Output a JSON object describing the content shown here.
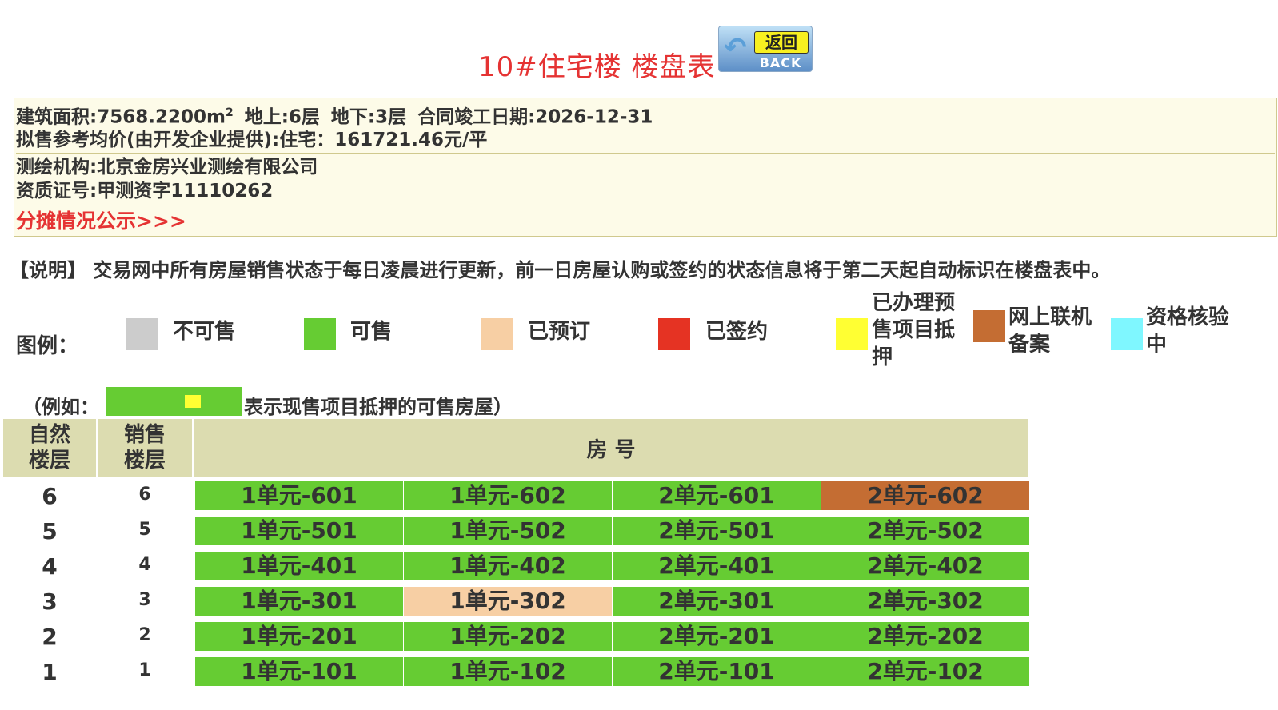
{
  "page": {
    "title": "10#住宅楼 楼盘表",
    "back_button": {
      "cn": "返回",
      "en": "BACK"
    }
  },
  "info": {
    "area_label": "建筑面积:7568.2200m",
    "area_sup": "2",
    "above_ground": "地上:6层",
    "below_ground": "地下:3层",
    "completion_date": "合同竣工日期:2026-12-31",
    "reference_price": "拟售参考均价(由开发企业提供):住宅：161721.46元/平",
    "survey_org": "测绘机构:北京金房兴业测绘有限公司",
    "cert_no": "资质证号:甲测资字11110262",
    "allocation_link": "分摊情况公示>>>"
  },
  "note": "【说明】 交易网中所有房屋销售状态于每日凌晨进行更新，前一日房屋认购或签约的状态信息将于第二天起自动标识在楼盘表中。",
  "legend": {
    "label": "图例：",
    "items": [
      {
        "label": "不可售",
        "color": "#cccccc"
      },
      {
        "label": "可售",
        "color": "#66cc33"
      },
      {
        "label": "已预订",
        "color": "#f7cfa4"
      },
      {
        "label": "已签约",
        "color": "#e53323"
      },
      {
        "label": "已办理预售项目抵押",
        "color": "#ffff33"
      },
      {
        "label": "网上联机备案",
        "color": "#c46d33"
      },
      {
        "label": "资格核验中",
        "color": "#7ff7ff"
      }
    ],
    "example_prefix": "（例如：",
    "example_suffix": "表示现售项目抵押的可售房屋）"
  },
  "table": {
    "headers": {
      "natural_floor": "自然楼层",
      "sale_floor": "销售楼层",
      "room_no": "房 号"
    },
    "rows": [
      {
        "natural": "6",
        "sale": "6",
        "units": [
          {
            "name": "1单元-601",
            "status": "available"
          },
          {
            "name": "1单元-602",
            "status": "available"
          },
          {
            "name": "2单元-601",
            "status": "available"
          },
          {
            "name": "2单元-602",
            "status": "filed"
          }
        ]
      },
      {
        "natural": "5",
        "sale": "5",
        "units": [
          {
            "name": "1单元-501",
            "status": "available"
          },
          {
            "name": "1单元-502",
            "status": "available"
          },
          {
            "name": "2单元-501",
            "status": "available"
          },
          {
            "name": "2单元-502",
            "status": "available"
          }
        ]
      },
      {
        "natural": "4",
        "sale": "4",
        "units": [
          {
            "name": "1单元-401",
            "status": "available"
          },
          {
            "name": "1单元-402",
            "status": "available"
          },
          {
            "name": "2单元-401",
            "status": "available"
          },
          {
            "name": "2单元-402",
            "status": "available"
          }
        ]
      },
      {
        "natural": "3",
        "sale": "3",
        "units": [
          {
            "name": "1单元-301",
            "status": "available"
          },
          {
            "name": "1单元-302",
            "status": "reserved"
          },
          {
            "name": "2单元-301",
            "status": "available"
          },
          {
            "name": "2单元-302",
            "status": "available"
          }
        ]
      },
      {
        "natural": "2",
        "sale": "2",
        "units": [
          {
            "name": "1单元-201",
            "status": "available"
          },
          {
            "name": "1单元-202",
            "status": "available"
          },
          {
            "name": "2单元-201",
            "status": "available"
          },
          {
            "name": "2单元-202",
            "status": "available"
          }
        ]
      },
      {
        "natural": "1",
        "sale": "1",
        "units": [
          {
            "name": "1单元-101",
            "status": "available"
          },
          {
            "name": "1单元-102",
            "status": "available"
          },
          {
            "name": "2单元-101",
            "status": "available"
          },
          {
            "name": "2单元-102",
            "status": "available"
          }
        ]
      }
    ],
    "status_colors": {
      "available": "#66cc33",
      "reserved": "#f7cfa4",
      "filed": "#c46d33"
    }
  }
}
